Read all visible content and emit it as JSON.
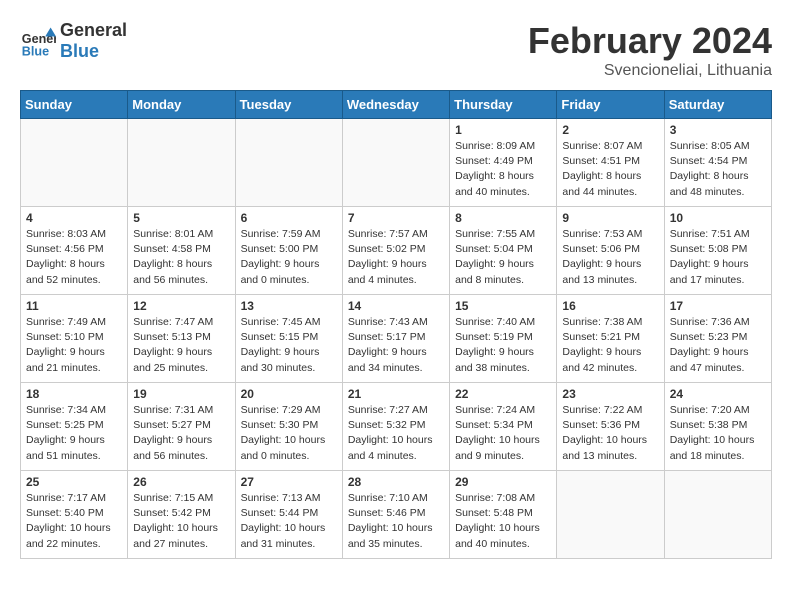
{
  "header": {
    "logo_line1": "General",
    "logo_line2": "Blue",
    "month_title": "February 2024",
    "location": "Svencioneliai, Lithuania"
  },
  "weekdays": [
    "Sunday",
    "Monday",
    "Tuesday",
    "Wednesday",
    "Thursday",
    "Friday",
    "Saturday"
  ],
  "weeks": [
    [
      {
        "day": "",
        "info": ""
      },
      {
        "day": "",
        "info": ""
      },
      {
        "day": "",
        "info": ""
      },
      {
        "day": "",
        "info": ""
      },
      {
        "day": "1",
        "info": "Sunrise: 8:09 AM\nSunset: 4:49 PM\nDaylight: 8 hours\nand 40 minutes."
      },
      {
        "day": "2",
        "info": "Sunrise: 8:07 AM\nSunset: 4:51 PM\nDaylight: 8 hours\nand 44 minutes."
      },
      {
        "day": "3",
        "info": "Sunrise: 8:05 AM\nSunset: 4:54 PM\nDaylight: 8 hours\nand 48 minutes."
      }
    ],
    [
      {
        "day": "4",
        "info": "Sunrise: 8:03 AM\nSunset: 4:56 PM\nDaylight: 8 hours\nand 52 minutes."
      },
      {
        "day": "5",
        "info": "Sunrise: 8:01 AM\nSunset: 4:58 PM\nDaylight: 8 hours\nand 56 minutes."
      },
      {
        "day": "6",
        "info": "Sunrise: 7:59 AM\nSunset: 5:00 PM\nDaylight: 9 hours\nand 0 minutes."
      },
      {
        "day": "7",
        "info": "Sunrise: 7:57 AM\nSunset: 5:02 PM\nDaylight: 9 hours\nand 4 minutes."
      },
      {
        "day": "8",
        "info": "Sunrise: 7:55 AM\nSunset: 5:04 PM\nDaylight: 9 hours\nand 8 minutes."
      },
      {
        "day": "9",
        "info": "Sunrise: 7:53 AM\nSunset: 5:06 PM\nDaylight: 9 hours\nand 13 minutes."
      },
      {
        "day": "10",
        "info": "Sunrise: 7:51 AM\nSunset: 5:08 PM\nDaylight: 9 hours\nand 17 minutes."
      }
    ],
    [
      {
        "day": "11",
        "info": "Sunrise: 7:49 AM\nSunset: 5:10 PM\nDaylight: 9 hours\nand 21 minutes."
      },
      {
        "day": "12",
        "info": "Sunrise: 7:47 AM\nSunset: 5:13 PM\nDaylight: 9 hours\nand 25 minutes."
      },
      {
        "day": "13",
        "info": "Sunrise: 7:45 AM\nSunset: 5:15 PM\nDaylight: 9 hours\nand 30 minutes."
      },
      {
        "day": "14",
        "info": "Sunrise: 7:43 AM\nSunset: 5:17 PM\nDaylight: 9 hours\nand 34 minutes."
      },
      {
        "day": "15",
        "info": "Sunrise: 7:40 AM\nSunset: 5:19 PM\nDaylight: 9 hours\nand 38 minutes."
      },
      {
        "day": "16",
        "info": "Sunrise: 7:38 AM\nSunset: 5:21 PM\nDaylight: 9 hours\nand 42 minutes."
      },
      {
        "day": "17",
        "info": "Sunrise: 7:36 AM\nSunset: 5:23 PM\nDaylight: 9 hours\nand 47 minutes."
      }
    ],
    [
      {
        "day": "18",
        "info": "Sunrise: 7:34 AM\nSunset: 5:25 PM\nDaylight: 9 hours\nand 51 minutes."
      },
      {
        "day": "19",
        "info": "Sunrise: 7:31 AM\nSunset: 5:27 PM\nDaylight: 9 hours\nand 56 minutes."
      },
      {
        "day": "20",
        "info": "Sunrise: 7:29 AM\nSunset: 5:30 PM\nDaylight: 10 hours\nand 0 minutes."
      },
      {
        "day": "21",
        "info": "Sunrise: 7:27 AM\nSunset: 5:32 PM\nDaylight: 10 hours\nand 4 minutes."
      },
      {
        "day": "22",
        "info": "Sunrise: 7:24 AM\nSunset: 5:34 PM\nDaylight: 10 hours\nand 9 minutes."
      },
      {
        "day": "23",
        "info": "Sunrise: 7:22 AM\nSunset: 5:36 PM\nDaylight: 10 hours\nand 13 minutes."
      },
      {
        "day": "24",
        "info": "Sunrise: 7:20 AM\nSunset: 5:38 PM\nDaylight: 10 hours\nand 18 minutes."
      }
    ],
    [
      {
        "day": "25",
        "info": "Sunrise: 7:17 AM\nSunset: 5:40 PM\nDaylight: 10 hours\nand 22 minutes."
      },
      {
        "day": "26",
        "info": "Sunrise: 7:15 AM\nSunset: 5:42 PM\nDaylight: 10 hours\nand 27 minutes."
      },
      {
        "day": "27",
        "info": "Sunrise: 7:13 AM\nSunset: 5:44 PM\nDaylight: 10 hours\nand 31 minutes."
      },
      {
        "day": "28",
        "info": "Sunrise: 7:10 AM\nSunset: 5:46 PM\nDaylight: 10 hours\nand 35 minutes."
      },
      {
        "day": "29",
        "info": "Sunrise: 7:08 AM\nSunset: 5:48 PM\nDaylight: 10 hours\nand 40 minutes."
      },
      {
        "day": "",
        "info": ""
      },
      {
        "day": "",
        "info": ""
      }
    ]
  ]
}
